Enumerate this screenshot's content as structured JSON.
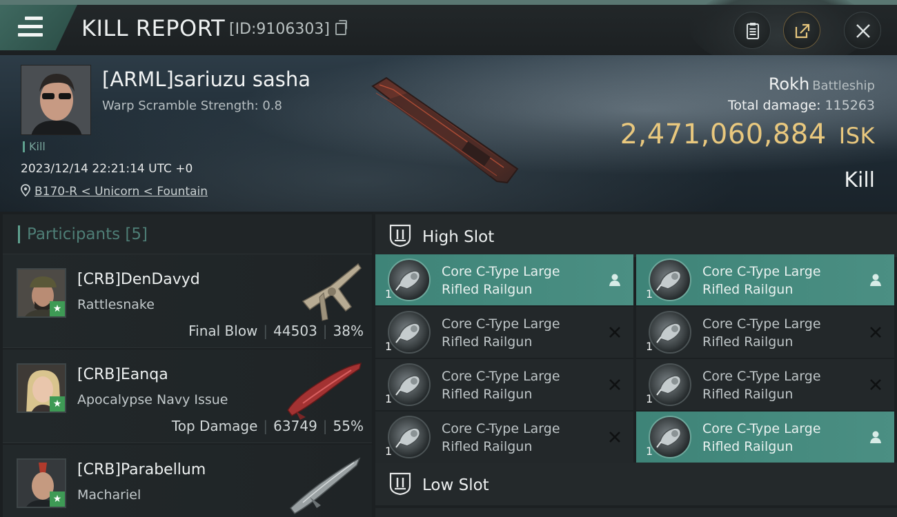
{
  "header": {
    "title": "KILL REPORT",
    "report_id": "[ID:9106303]",
    "buttons": [
      "clipboard-icon",
      "share-icon",
      "close-icon"
    ]
  },
  "victim": {
    "name": "[ARML]sariuzu sasha",
    "warp_scramble": "Warp Scramble Strength: 0.8",
    "tag": "Kill",
    "datetime": "2023/12/14 22:21:14 UTC +0",
    "location": "B170-R < Unicorn < Fountain",
    "ship_name": "Rokh",
    "ship_class": "Battleship",
    "total_damage_label": "Total damage:",
    "total_damage": "115263",
    "isk_value": "2,471,060,884",
    "isk_unit": "ISK",
    "result": "Kill"
  },
  "participants": {
    "label": "Participants",
    "count": "[5]",
    "rows": [
      {
        "name": "[CRB]DenDavyd",
        "ship": "Rattlesnake",
        "role": "Final Blow",
        "damage": "44503",
        "percent": "38%"
      },
      {
        "name": "[CRB]Eanqa",
        "ship": "Apocalypse Navy Issue",
        "role": "Top Damage",
        "damage": "63749",
        "percent": "55%"
      },
      {
        "name": "[CRB]Parabellum",
        "ship": "Machariel",
        "role": "",
        "damage": "",
        "percent": ""
      }
    ]
  },
  "slots": {
    "high_label": "High Slot",
    "low_label": "Low Slot",
    "high_items": [
      {
        "line1": "Core C-Type Large",
        "line2": "Rifled Railgun",
        "qty": "1",
        "state": "dropped"
      },
      {
        "line1": "Core C-Type Large",
        "line2": "Rifled Railgun",
        "qty": "1",
        "state": "dropped"
      },
      {
        "line1": "Core C-Type Large",
        "line2": "Rifled Railgun",
        "qty": "1",
        "state": "destroyed"
      },
      {
        "line1": "Core C-Type Large",
        "line2": "Rifled Railgun",
        "qty": "1",
        "state": "destroyed"
      },
      {
        "line1": "Core C-Type Large",
        "line2": "Rifled Railgun",
        "qty": "1",
        "state": "destroyed"
      },
      {
        "line1": "Core C-Type Large",
        "line2": "Rifled Railgun",
        "qty": "1",
        "state": "destroyed"
      },
      {
        "line1": "Core C-Type Large",
        "line2": "Rifled Railgun",
        "qty": "1",
        "state": "destroyed"
      },
      {
        "line1": "Core C-Type Large",
        "line2": "Rifled Railgun",
        "qty": "1",
        "state": "dropped"
      }
    ]
  }
}
